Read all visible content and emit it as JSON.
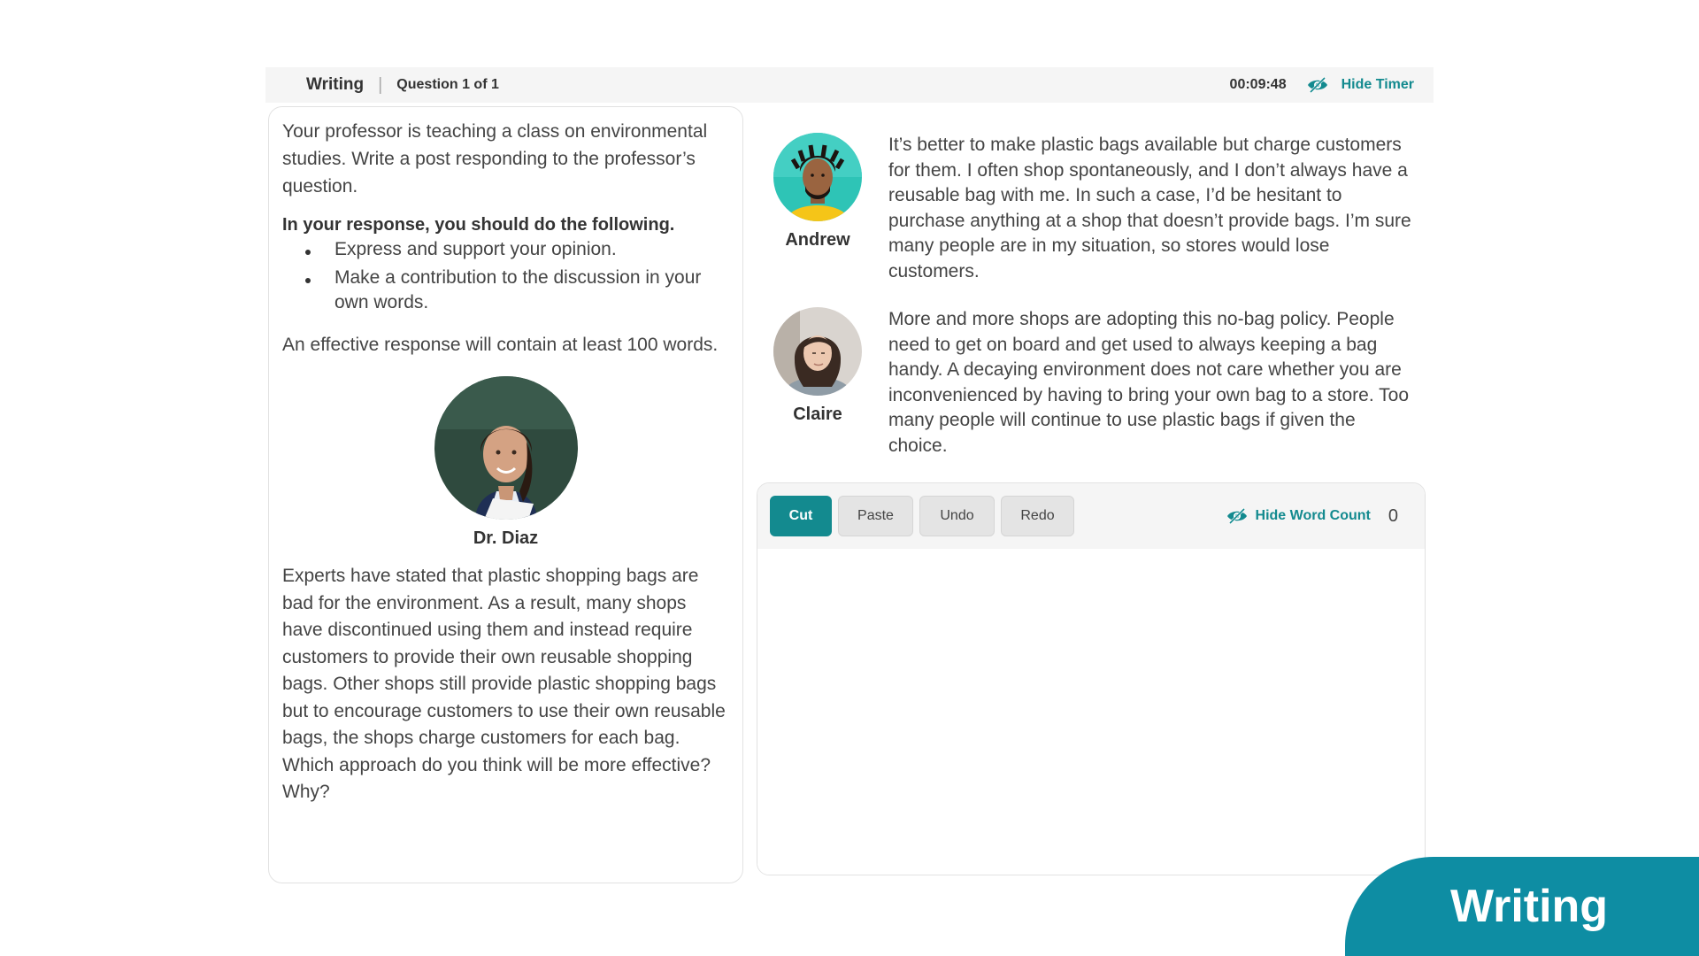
{
  "header": {
    "section": "Writing",
    "separator": "|",
    "question_counter": "Question 1 of 1",
    "timer": "00:09:48",
    "hide_timer_label": "Hide Timer",
    "eye_icon": "eye-icon"
  },
  "prompt": {
    "intro": "Your professor is teaching a class on environmental studies. Write a post responding to the professor’s question.",
    "instructions_heading": "In your response, you should do the following.",
    "bullets": [
      "Express and support your opinion.",
      "Make a contribution to the discussion in your own words."
    ],
    "effective": "An effective response will contain at least 100 words.",
    "professor": {
      "name": "Dr. Diaz",
      "text": "Experts have stated that plastic shopping bags are bad for the environment. As a result, many shops have discontinued using them and instead require customers to provide their own reusable shopping bags. Other shops still provide plastic shopping bags but to encourage customers to use their own reusable bags, the shops charge customers for each bag. Which approach do you think will be more effective? Why?"
    }
  },
  "students": [
    {
      "name": "Andrew",
      "post": "It’s better to make plastic bags available but charge customers for them. I often shop spontaneously, and I don’t always have a reusable bag with me. In such a case, I’d be hesitant to purchase anything at a shop that doesn’t provide bags. I’m sure many people are in my situation, so stores would lose customers."
    },
    {
      "name": "Claire",
      "post": "More and more shops are adopting this no-bag policy. People need to get on board and get used to always keeping a bag handy. A decaying environment does not care whether you are inconvenienced by having to bring your own bag to a store. Too many people will continue to use plastic bags if given the choice."
    }
  ],
  "editor": {
    "buttons": {
      "cut": "Cut",
      "paste": "Paste",
      "undo": "Undo",
      "redo": "Redo"
    },
    "hide_word_count_label": "Hide Word Count",
    "word_count": "0",
    "response_text": ""
  },
  "badge": {
    "label": "Writing"
  },
  "colors": {
    "accent": "#138a8f",
    "badge": "#0e8da3"
  }
}
